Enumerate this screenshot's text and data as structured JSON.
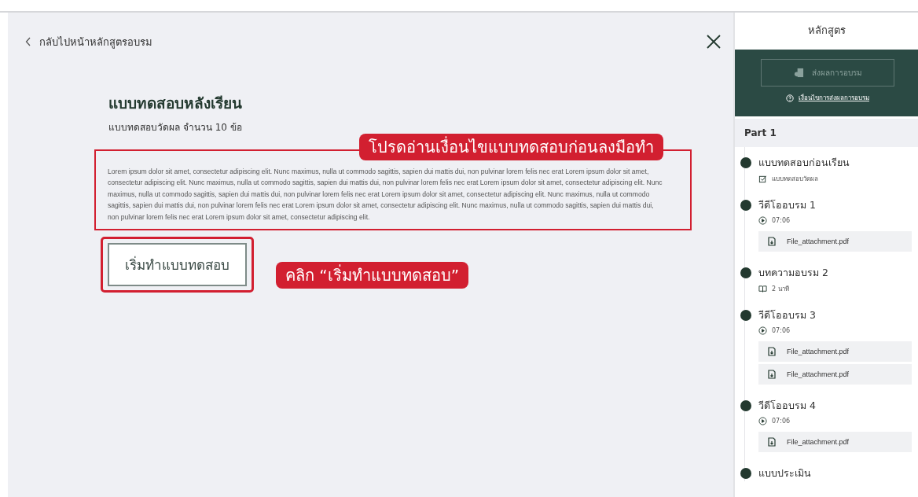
{
  "back_link": "กลับไปหน้าหลักสูตรอบรม",
  "quiz": {
    "title": "แบบทดสอบหลังเรียน",
    "subtitle": "แบบทดสอบวัดผล จำนวน 10 ข้อ",
    "description": "Lorem ipsum dolor sit amet, consectetur adipiscing elit. Nunc maximus, nulla ut commodo sagittis, sapien dui mattis dui, non pulvinar lorem felis nec erat Lorem ipsum dolor sit amet, consectetur adipiscing elit. Nunc maximus, nulla ut commodo sagittis, sapien dui mattis dui, non pulvinar lorem felis nec erat Lorem ipsum dolor sit amet, consectetur adipiscing elit. Nunc maximus, nulla ut commodo sagittis, sapien dui mattis dui, non pulvinar lorem felis nec erat Lorem ipsum dolor sit amet, consectetur adipiscing elit. Nunc maximus, nulla ut commodo sagittis, sapien dui mattis dui, non pulvinar lorem felis nec erat Lorem ipsum dolor sit amet, consectetur adipiscing elit. Nunc maximus, nulla ut commodo sagittis, sapien dui mattis dui, non pulvinar lorem felis nec erat Lorem ipsum dolor sit amet, consectetur adipiscing elit.",
    "start_button": "เริ่มทำแบบทดสอบ"
  },
  "annotations": [
    {
      "kind": "top",
      "text": "โปรดอ่านเงื่อนไขแบบทดสอบก่อนลงมือทำ"
    },
    {
      "kind": "side",
      "text": "คลิก “เริ่มทำแบบทดสอบ”"
    }
  ],
  "sidebar": {
    "title": "หลักสูตร",
    "submit_button": {
      "label": "ส่งผลการอบรม",
      "disabled": true
    },
    "conditions_link": "เงื่อนไขการส่งผลการอบรม",
    "sections": [
      {
        "title": "Part 1",
        "items": [
          {
            "kind": "quiz",
            "title": "แบบทดสอบก่อนเรียน",
            "meta": "แบบทดสอบวัดผล"
          },
          {
            "kind": "video",
            "title": "วีดีโออบรม 1",
            "meta": "07:06",
            "attachments": [
              "File_attachment.pdf"
            ]
          },
          {
            "kind": "article",
            "title": "บทความอบรม 2",
            "meta": "2 นาที"
          },
          {
            "kind": "video",
            "title": "วีดีโออบรม 3",
            "meta": "07:06",
            "attachments": [
              "File_attachment.pdf",
              "File_attachment.pdf"
            ]
          },
          {
            "kind": "video",
            "title": "วีดีโออบรม 4",
            "meta": "07:06",
            "attachments": [
              "File_attachment.pdf"
            ]
          },
          {
            "title": "แบบประเมิน"
          }
        ]
      }
    ]
  }
}
